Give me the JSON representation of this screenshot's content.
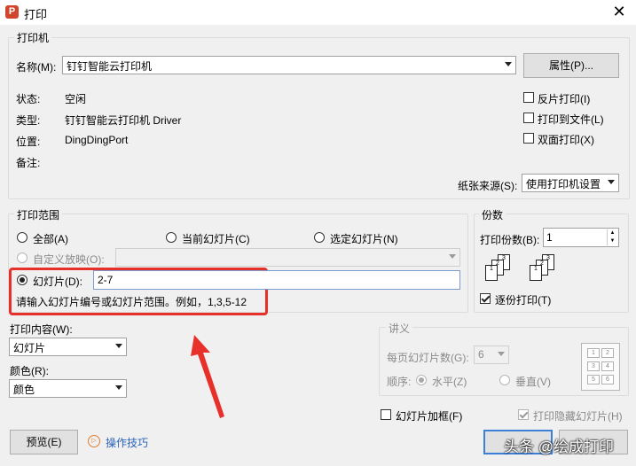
{
  "window": {
    "app_icon": "P",
    "title": "打印",
    "close_glyph": "✕"
  },
  "printer": {
    "group_title": "打印机",
    "name_label": "名称(M):",
    "name_value": "钉钉智能云打印机",
    "properties_button": "属性(P)...",
    "status_label": "状态:",
    "status_value": "空闲",
    "type_label": "类型:",
    "type_value": "钉钉智能云打印机 Driver",
    "location_label": "位置:",
    "location_value": "DingDingPort",
    "comment_label": "备注:",
    "reverse_print": "反片打印(I)",
    "print_to_file": "打印到文件(L)",
    "duplex": "双面打印(X)",
    "paper_source_label": "纸张来源(S):",
    "paper_source_value": "使用打印机设置"
  },
  "range": {
    "group_title": "打印范围",
    "all": "全部(A)",
    "current_slide": "当前幻灯片(C)",
    "selected_slides": "选定幻灯片(N)",
    "custom_show": "自定义放映(O):",
    "slides": "幻灯片(D):",
    "slides_value": "2-7",
    "hint": "请输入幻灯片编号或幻灯片范围。例如，1,3,5-12"
  },
  "copies": {
    "group_title": "份数",
    "count_label": "打印份数(B):",
    "count_value": "1",
    "collate": "逐份打印(T)",
    "stack_a": [
      "1",
      "2",
      "3"
    ],
    "stack_b": [
      "1",
      "2",
      "3"
    ]
  },
  "content": {
    "what_label": "打印内容(W):",
    "what_value": "幻灯片",
    "color_label": "颜色(R):",
    "color_value": "颜色"
  },
  "handouts": {
    "group_title": "讲义",
    "per_page_label": "每页幻灯片数(G):",
    "per_page_value": "6",
    "order_label": "顺序:",
    "horizontal": "水平(Z)",
    "vertical": "垂直(V)",
    "grid": [
      "1",
      "2",
      "3",
      "4",
      "5",
      "6"
    ]
  },
  "options": {
    "frame_slides": "幻灯片加框(F)",
    "print_hidden": "打印隐藏幻灯片(H)"
  },
  "footer": {
    "preview_button": "预览(E)",
    "tips_link": "操作技巧",
    "tips_icon": "▷",
    "watermark": "头条 @绘成打印"
  },
  "colors": {
    "annotation_red": "#e8302a",
    "link_blue": "#2a62b8"
  }
}
